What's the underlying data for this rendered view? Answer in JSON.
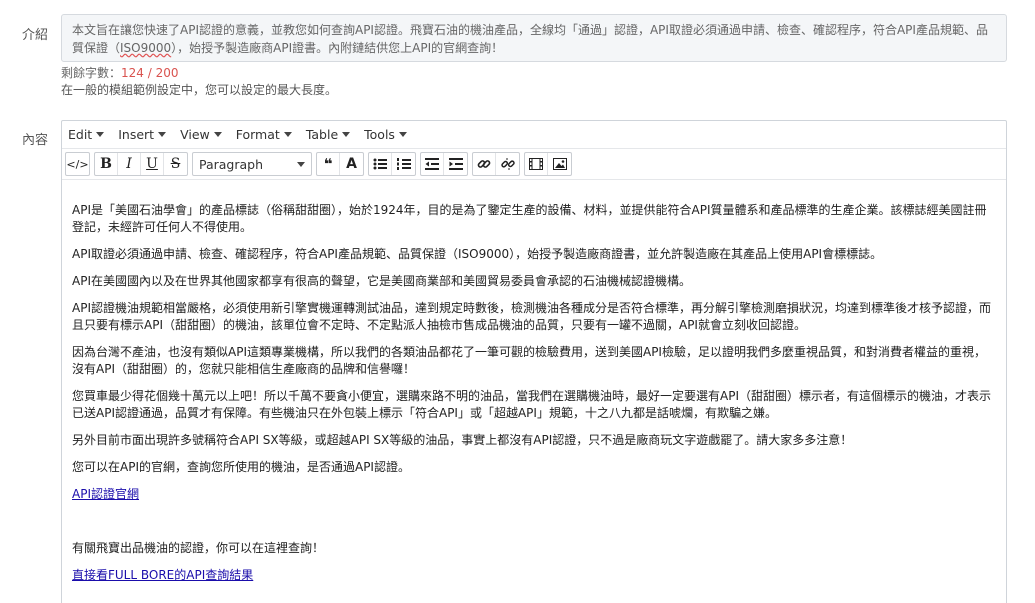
{
  "intro": {
    "label": "介紹",
    "text_before": "本文旨在讓您快速了API認證的意義，並教您如何查詢API認證。飛寶石油的機油產品，全線均「通過」認證，API取證必須通過申請、檢查、確認程序，符合API產品規範、品質保證（",
    "squiggle": "ISO9000",
    "text_after": "），始授予製造廠商API證書。內附鏈結供您上API的官網查詢！",
    "counter_label": "剩餘字數：",
    "counter_value": "124 / 200",
    "hint": "在一般的模組範例設定中，您可以設定的最大長度。"
  },
  "content": {
    "label": "內容",
    "menubar": [
      "Edit",
      "Insert",
      "View",
      "Format",
      "Table",
      "Tools"
    ],
    "toolbar": {
      "code": "</>",
      "bold": "B",
      "italic": "I",
      "underline": "U",
      "strike": "S",
      "block_format": "Paragraph",
      "quote": "❝",
      "font": "A"
    },
    "paragraphs": [
      "API是「美國石油學會」的產品標誌（俗稱甜甜圈），始於1924年，目的是為了鑒定生產的設備、材料，並提供能符合API質量體系和產品標準的生產企業。該標誌經美國註冊登記，未經許可任何人不得使用。",
      "API取證必須通過申請、檢查、確認程序，符合API產品規範、品質保證（ISO9000），始授予製造廠商證書，並允許製造廠在其產品上使用API會標標誌。",
      "API在美國國內以及在世界其他國家都享有很高的聲望，它是美國商業部和美國貿易委員會承認的石油機械認證機構。",
      "API認證機油規範相當嚴格，必須使用新引擎實機運轉測試油品，達到規定時數後，檢測機油各種成分是否符合標準，再分解引擎檢測磨損狀況，均達到標準後才核予認證，而且只要有標示API（甜甜圈）的機油，該單位會不定時、不定點派人抽檢市售成品機油的品質，只要有一罐不過關，API就會立刻收回認證。",
      "因為台灣不產油，也沒有類似API這類專業機構，所以我們的各類油品都花了一筆可觀的檢驗費用，送到美國API檢驗，足以證明我們多麼重視品質，和對消費者權益的重視，沒有API（甜甜圈）的，您就只能相信生產廠商的品牌和信譽囉！",
      "您買車最少得花個幾十萬元以上吧！所以千萬不要貪小便宜，選購來路不明的油品，當我們在選購機油時，最好一定要選有API（甜甜圈）標示者，有這個標示的機油，才表示已送API認證通過，品質才有保障。有些機油只在外包裝上標示「符合API」或「超越API」規範，十之八九都是話唬爛，有欺騙之嫌。",
      "另外目前市面出現許多號稱符合API SX等級，或超越API SX等級的油品，事實上都沒有API認證，只不過是廠商玩文字遊戲罷了。請大家多多注意！",
      "您可以在API的官網，查詢您所使用的機油，是否通過API認證。"
    ],
    "link1": "API認證官網",
    "paragraph_last": "有關飛寶出品機油的認證，你可以在這裡查詢！",
    "link2": "直接看FULL BORE的API查詢結果"
  }
}
